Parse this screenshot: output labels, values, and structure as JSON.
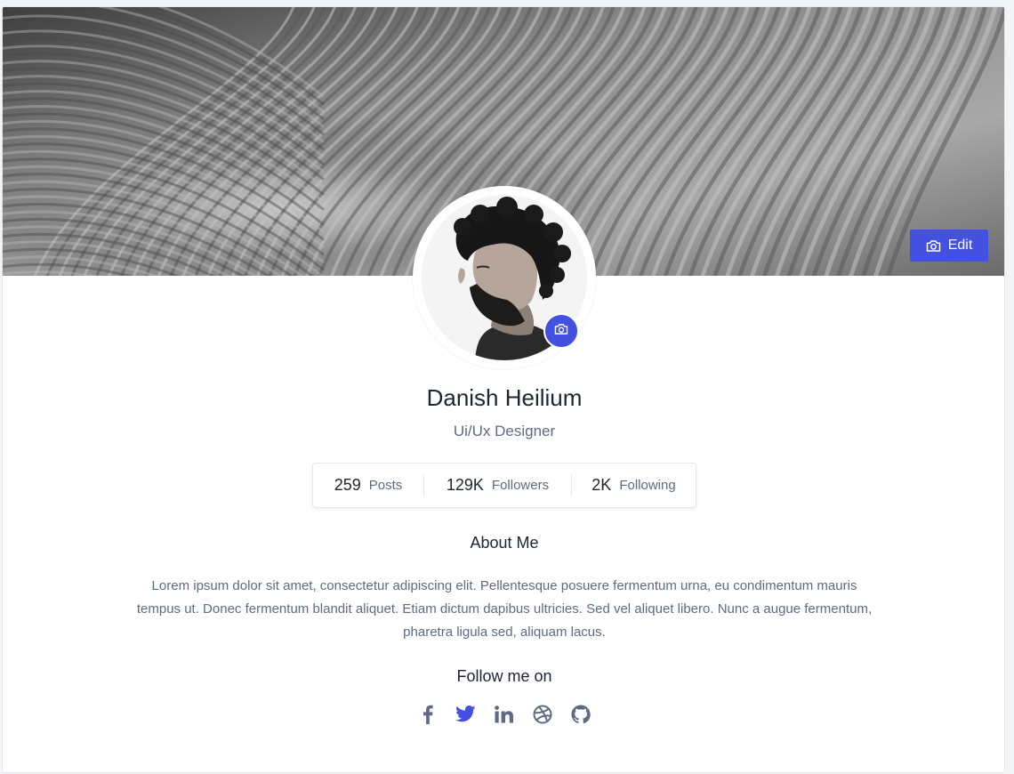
{
  "profile": {
    "name": "Danish Heilium",
    "role": "Ui/Ux Designer",
    "edit_label": "Edit"
  },
  "stats": [
    {
      "value": "259",
      "label": "Posts"
    },
    {
      "value": "129K",
      "label": "Followers"
    },
    {
      "value": "2K",
      "label": "Following"
    }
  ],
  "about": {
    "title": "About Me",
    "text": "Lorem ipsum dolor sit amet, consectetur adipiscing elit. Pellentesque posuere fermentum urna, eu condimentum mauris tempus ut. Donec fermentum blandit aliquet. Etiam dictum dapibus ultricies. Sed vel aliquet libero. Nunc a augue fermentum, pharetra ligula sed, aliquam lacus."
  },
  "follow": {
    "title": "Follow me on",
    "networks": [
      {
        "icon": "facebook-icon",
        "color": "#5e6b82"
      },
      {
        "icon": "twitter-icon",
        "color": "#4450e0"
      },
      {
        "icon": "linkedin-icon",
        "color": "#5e6b82"
      },
      {
        "icon": "dribbble-icon",
        "color": "#5e6b82"
      },
      {
        "icon": "github-icon",
        "color": "#5e6b82"
      }
    ]
  },
  "colors": {
    "accent": "#4450e0",
    "muted_text": "#5e6b82",
    "heading_text": "#1f2433"
  },
  "icons": {
    "edit_button": "camera-icon",
    "avatar_button": "camera-icon"
  }
}
